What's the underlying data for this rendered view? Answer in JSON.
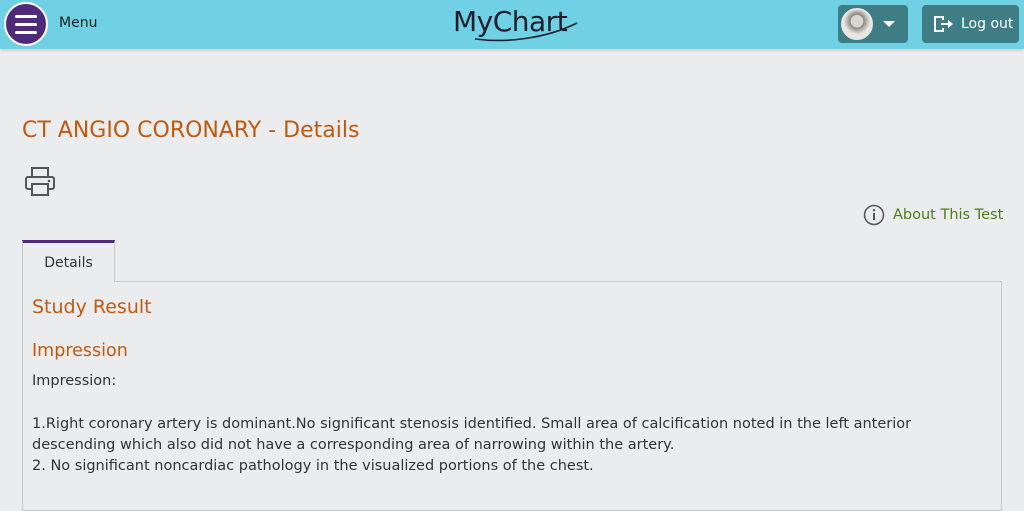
{
  "header": {
    "menu_label": "Menu",
    "logo_text": "MyChart",
    "logout_label": "Log out",
    "colors": {
      "bar": "#70d0e4",
      "menu_button": "#4f2a7a",
      "action_button": "#3f7d85"
    }
  },
  "page": {
    "title": "CT ANGIO CORONARY - Details",
    "about_link": "About This Test",
    "tabs": [
      {
        "label": "Details",
        "active": true
      }
    ],
    "colors": {
      "heading": "#c05a10",
      "link": "#4e7d16",
      "tab_accent": "#4f2a7a"
    }
  },
  "report": {
    "section_title": "Study Result",
    "subsection_title": "Impression",
    "label": "Impression:",
    "lines": [
      "1.Right coronary artery is dominant.No significant stenosis identified. Small area of calcification noted in the left anterior descending which also did not have a corresponding area of narrowing within the artery.",
      "2. No significant noncardiac pathology in the visualized portions of the chest."
    ]
  },
  "icons": {
    "menu": "hamburger-icon",
    "user": "avatar-photo",
    "dropdown": "caret-down-icon",
    "logout": "logout-icon",
    "print": "printer-icon",
    "info": "info-circle-icon"
  }
}
